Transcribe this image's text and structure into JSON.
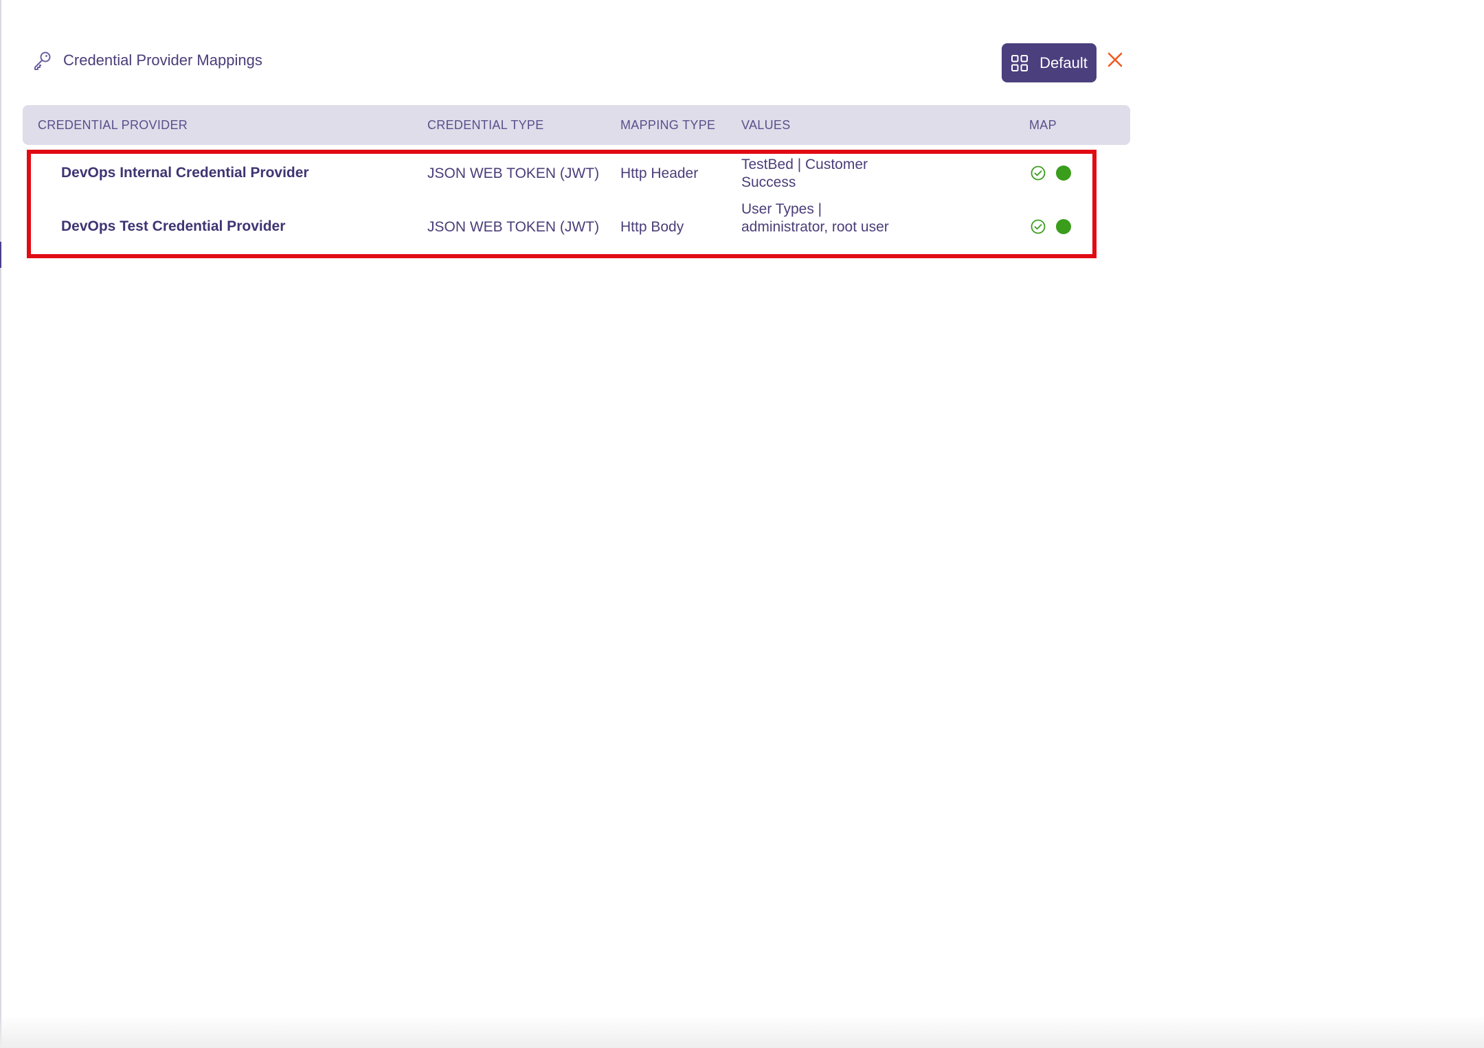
{
  "header": {
    "title": "Credential Provider Mappings",
    "icon": "key-icon"
  },
  "toolbar": {
    "default_label": "Default",
    "default_icon": "grid-icon",
    "close_icon": "close-icon"
  },
  "table": {
    "columns": [
      "CREDENTIAL PROVIDER",
      "CREDENTIAL TYPE",
      "MAPPING TYPE",
      "VALUES",
      "MAP"
    ],
    "rows": [
      {
        "provider": "DevOps Internal Credential Provider",
        "credential_type": "JSON WEB TOKEN (JWT)",
        "mapping_type": "Http Header",
        "values": "TestBed | Customer Success"
      },
      {
        "provider": "DevOps Test Credential Provider",
        "credential_type": "JSON WEB TOKEN (JWT)",
        "mapping_type": "Http Body",
        "values": "User Types | administrator, root user"
      }
    ]
  },
  "colors": {
    "accent": "#4b3f7e",
    "header_bg": "#dedde9",
    "highlight": "#e10b14",
    "status_green": "#3a9d1c",
    "close": "#f05a1e"
  }
}
